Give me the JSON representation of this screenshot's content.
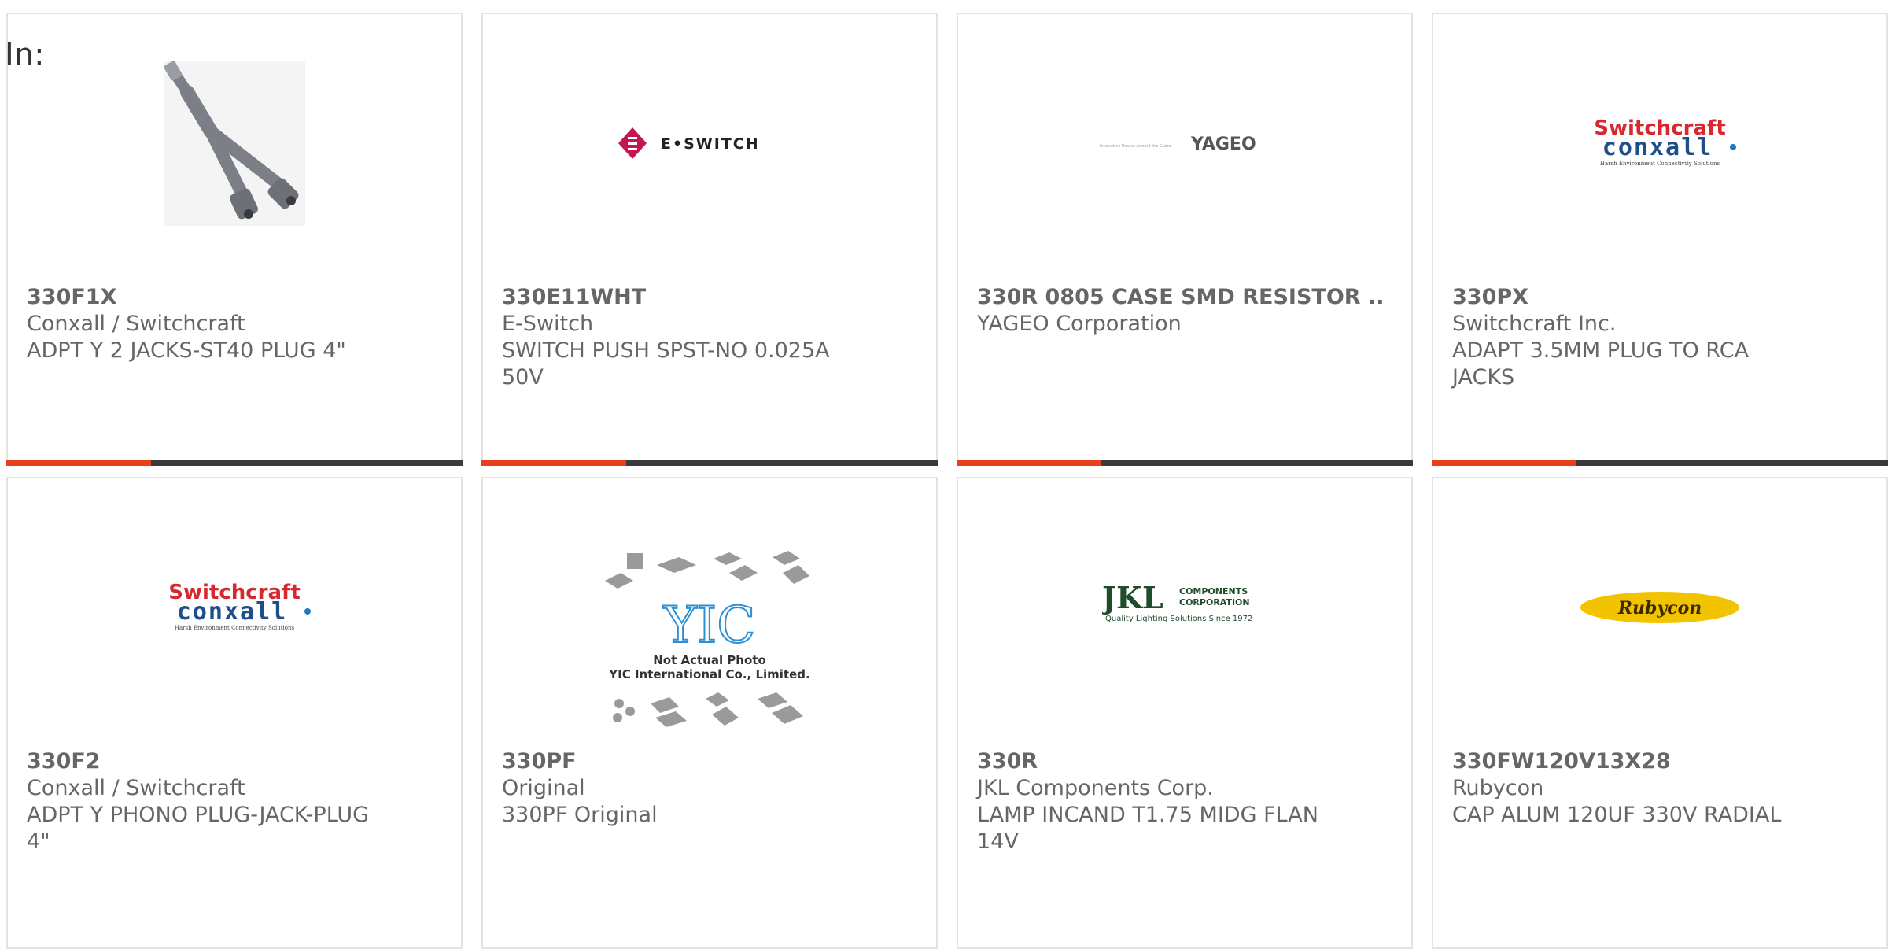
{
  "header": {
    "label": "In:"
  },
  "accent_color": "#e8401b",
  "cards": [
    {
      "part_number": "330F1X",
      "manufacturer": "Conxall / Switchcraft",
      "description": "ADPT Y 2 JACKS-ST40 PLUG 4\"",
      "image": "y-cable-adapter-photo"
    },
    {
      "part_number": "330E11WHT",
      "manufacturer": "E-Switch",
      "description": "SWITCH PUSH SPST-NO 0.025A 50V",
      "image": "eswitch-logo",
      "logo_text": "E•SWITCH"
    },
    {
      "part_number": "330R 0805 CASE SMD RESISTOR ..",
      "manufacturer": "YAGEO Corporation",
      "description": "",
      "image": "yageo-logo",
      "logo_text": "YAGEO",
      "logo_tagline": "Innovative Device Around the Globe"
    },
    {
      "part_number": "330PX",
      "manufacturer": "Switchcraft Inc.",
      "description": "ADAPT 3.5MM PLUG TO RCA JACKS",
      "image": "switchcraft-conxall-logo",
      "logo_top": "Switchcraft",
      "logo_bottom": "conxall",
      "logo_tagline": "Harsh Environment Connectivity Solutions"
    },
    {
      "part_number": "330F2",
      "manufacturer": "Conxall / Switchcraft",
      "description": "ADPT Y PHONO PLUG-JACK-PLUG 4\"",
      "image": "switchcraft-conxall-logo",
      "logo_top": "Switchcraft",
      "logo_bottom": "conxall",
      "logo_tagline": "Harsh Environment Connectivity Solutions"
    },
    {
      "part_number": "330PF",
      "manufacturer": "Original",
      "description": "330PF Original",
      "image": "yic-placeholder",
      "logo_text": "YIC",
      "logo_line1": "Not Actual Photo",
      "logo_line2": "YIC International Co., Limited."
    },
    {
      "part_number": "330R",
      "manufacturer": "JKL Components Corp.",
      "description": "LAMP INCAND T1.75 MIDG FLAN 14V",
      "image": "jkl-logo",
      "logo_text": "JKL",
      "logo_side1": "COMPONENTS",
      "logo_side2": "CORPORATION",
      "logo_tagline": "Quality Lighting Solutions Since 1972"
    },
    {
      "part_number": "330FW120V13X28",
      "manufacturer": "Rubycon",
      "description": "CAP ALUM 120UF 330V RADIAL",
      "image": "rubycon-logo",
      "logo_text": "Rubycon"
    }
  ]
}
